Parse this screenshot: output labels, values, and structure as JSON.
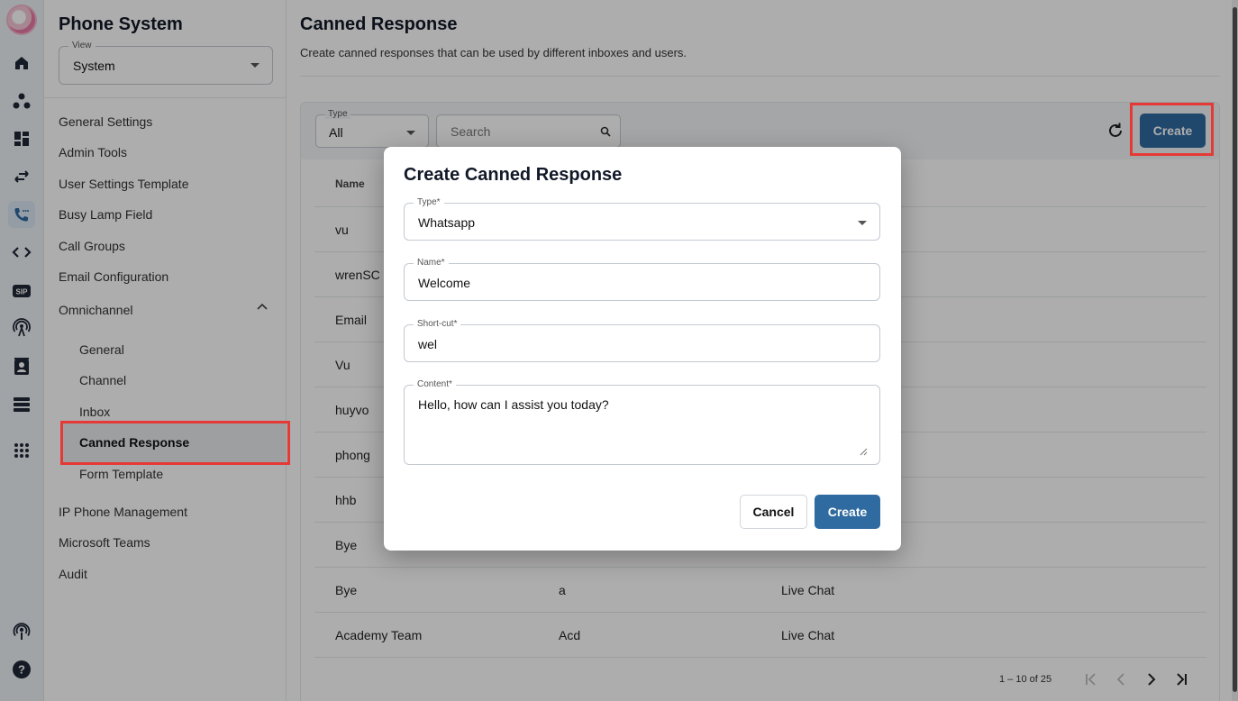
{
  "sidebar": {
    "title": "Phone System",
    "view_label": "View",
    "view_value": "System",
    "items": [
      {
        "label": "General Settings"
      },
      {
        "label": "Admin Tools"
      },
      {
        "label": "User Settings Template"
      },
      {
        "label": "Busy Lamp Field"
      },
      {
        "label": "Call Groups"
      },
      {
        "label": "Email Configuration"
      },
      {
        "label": "Omnichannel"
      }
    ],
    "omni_items": [
      {
        "label": "General"
      },
      {
        "label": "Channel"
      },
      {
        "label": "Inbox"
      },
      {
        "label": "Canned Response"
      },
      {
        "label": "Form Template"
      }
    ],
    "bottom_items": [
      {
        "label": "IP Phone Management"
      },
      {
        "label": "Microsoft Teams"
      },
      {
        "label": "Audit"
      }
    ]
  },
  "rail": {
    "icons": [
      "avatar",
      "home-icon",
      "org-icon",
      "dashboard-icon",
      "transfer-icon",
      "phone-icon",
      "code-icon",
      "sip-icon",
      "antenna-icon",
      "contacts-icon",
      "server-icon",
      "apps-icon",
      "podcast-icon",
      "help-icon"
    ],
    "sip_text": "SIP"
  },
  "page": {
    "title": "Canned Response",
    "description": "Create canned responses that can be used by different inboxes and users."
  },
  "toolbar": {
    "type_label": "Type",
    "type_value": "All",
    "search_placeholder": "Search",
    "create_label": "Create"
  },
  "table": {
    "name_header": "Name",
    "rows": [
      {
        "name": "vu",
        "shortcut": "",
        "type": ""
      },
      {
        "name": "wrenSC",
        "shortcut": "",
        "type": ""
      },
      {
        "name": "Email",
        "shortcut": "",
        "type": ""
      },
      {
        "name": "Vu",
        "shortcut": "",
        "type": ""
      },
      {
        "name": "huyvo",
        "shortcut": "",
        "type": ""
      },
      {
        "name": "phong",
        "shortcut": "",
        "type": ""
      },
      {
        "name": "hhb",
        "shortcut": "",
        "type": ""
      },
      {
        "name": "Bye",
        "shortcut": "",
        "type": ""
      },
      {
        "name": "Bye",
        "shortcut": "a",
        "type": "Live Chat"
      },
      {
        "name": "Academy Team",
        "shortcut": "Acd",
        "type": "Live Chat"
      }
    ]
  },
  "pagination": {
    "count_text": "1 – 10 of 25",
    "first_glyph": "|<",
    "prev_glyph": "<",
    "next_glyph": ">",
    "last_glyph": ">|"
  },
  "modal": {
    "title": "Create Canned Response",
    "type_label": "Type*",
    "type_value": "Whatsapp",
    "name_label": "Name*",
    "name_value": "Welcome",
    "shortcut_label": "Short-cut*",
    "shortcut_value": "wel",
    "content_label": "Content*",
    "content_value": "Hello, how can I assist you today?",
    "cancel_label": "Cancel",
    "create_label": "Create"
  },
  "colors": {
    "primary": "#2f6aa0",
    "highlight": "#e53935",
    "active_bg": "#e9ebee"
  }
}
